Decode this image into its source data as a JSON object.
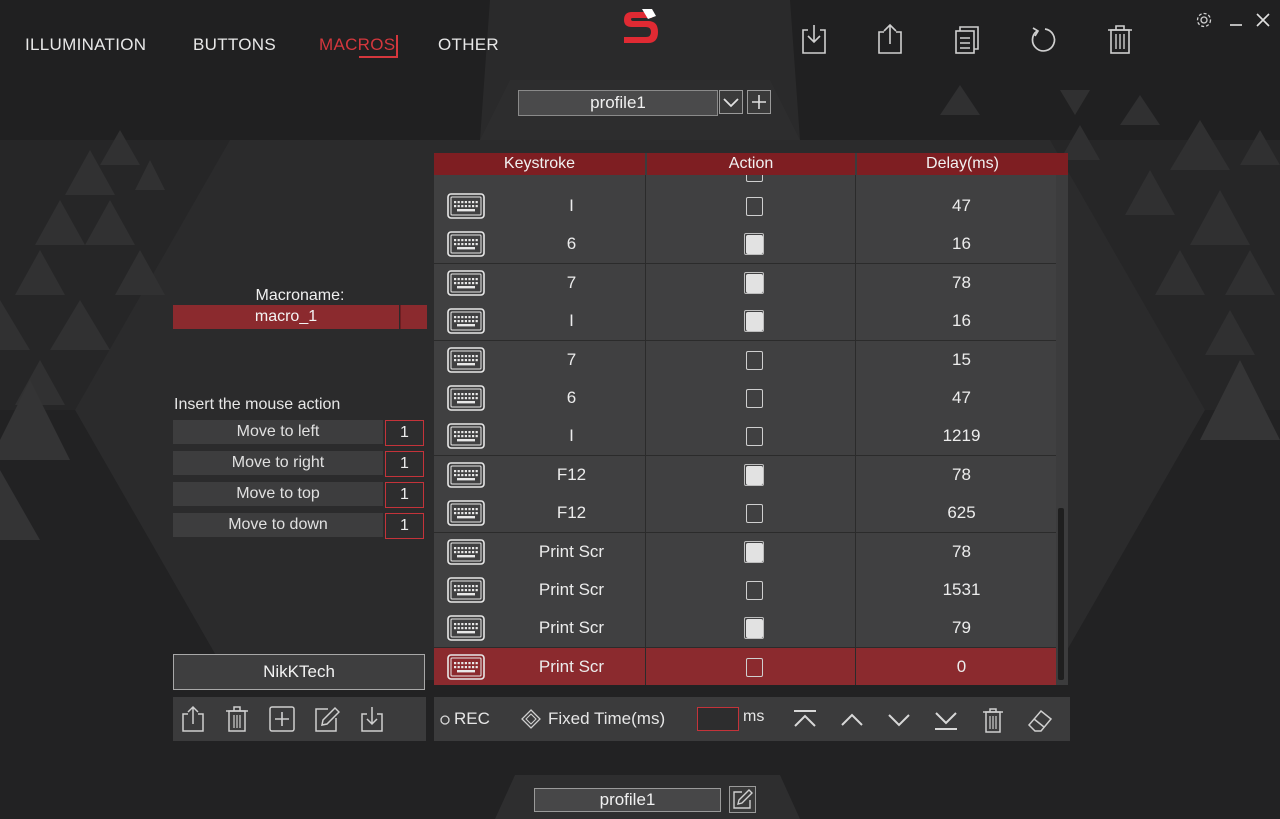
{
  "nav": {
    "tabs": [
      {
        "label": "ILLUMINATION",
        "active": false
      },
      {
        "label": "BUTTONS",
        "active": false
      },
      {
        "label": "MACROS",
        "active": true
      },
      {
        "label": "OTHER",
        "active": false
      }
    ]
  },
  "colors": {
    "accent": "#d4373d",
    "header_red": "#7e1e22",
    "selected_row": "#8b2a2e",
    "background": "#262627"
  },
  "toolbar_icons": [
    "import-icon",
    "export-icon",
    "copy-icon",
    "reset-icon",
    "delete-icon"
  ],
  "window_icons": [
    "settings-icon",
    "minimize-icon",
    "close-icon"
  ],
  "profile_top": {
    "value": "profile1"
  },
  "macroname": {
    "label": "Macroname:",
    "value": "macro_1"
  },
  "mouse_actions": {
    "title": "Insert the mouse action",
    "items": [
      {
        "label": "Move to left",
        "value": "1"
      },
      {
        "label": "Move to right",
        "value": "1"
      },
      {
        "label": "Move to top",
        "value": "1"
      },
      {
        "label": "Move to down",
        "value": "1"
      }
    ]
  },
  "macro_list": {
    "items": [
      "NikKTech"
    ]
  },
  "table": {
    "headers": [
      "Keystroke",
      "Action",
      "Delay(ms)"
    ],
    "rows": [
      {
        "key": "I",
        "pressed": false,
        "delay": "47"
      },
      {
        "key": "6",
        "pressed": true,
        "delay": "16"
      },
      {
        "key": "7",
        "pressed": true,
        "delay": "78"
      },
      {
        "key": "I",
        "pressed": true,
        "delay": "16"
      },
      {
        "key": "7",
        "pressed": false,
        "delay": "15"
      },
      {
        "key": "6",
        "pressed": false,
        "delay": "47"
      },
      {
        "key": "I",
        "pressed": false,
        "delay": "1219"
      },
      {
        "key": "F12",
        "pressed": true,
        "delay": "78"
      },
      {
        "key": "F12",
        "pressed": false,
        "delay": "625"
      },
      {
        "key": "Print Scr",
        "pressed": true,
        "delay": "78"
      },
      {
        "key": "Print Scr",
        "pressed": false,
        "delay": "1531"
      },
      {
        "key": "Print Scr",
        "pressed": true,
        "delay": "79"
      },
      {
        "key": "Print Scr",
        "pressed": false,
        "delay": "0",
        "selected": true
      }
    ]
  },
  "bottom_bar": {
    "rec_label": "REC",
    "fixed_time_label": "Fixed Time(ms)",
    "ms_value": "",
    "ms_unit": "ms"
  },
  "profile_bottom": {
    "value": "profile1"
  }
}
